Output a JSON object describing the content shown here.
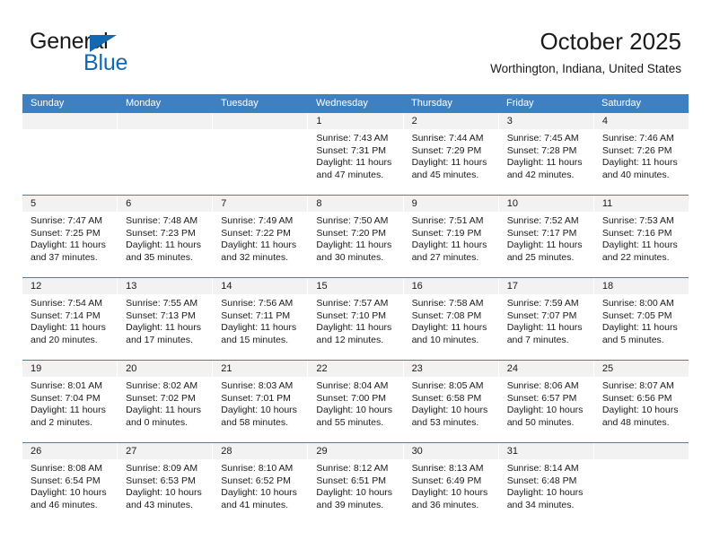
{
  "brand": {
    "name_top": "General",
    "name_bottom": "Blue",
    "accent_color": "#1268b3"
  },
  "header": {
    "title": "October 2025",
    "subtitle": "Worthington, Indiana, United States"
  },
  "theme": {
    "header_row_color": "#3f80c0",
    "daynum_band_color": "#f2f2f2",
    "text_color": "#1a1a1a"
  },
  "labels": {
    "sunrise_prefix": "Sunrise:",
    "sunset_prefix": "Sunset:",
    "daylight_prefix": "Daylight:"
  },
  "weekdays": [
    "Sunday",
    "Monday",
    "Tuesday",
    "Wednesday",
    "Thursday",
    "Friday",
    "Saturday"
  ],
  "weeks": [
    [
      {
        "day": "",
        "empty": true
      },
      {
        "day": "",
        "empty": true
      },
      {
        "day": "",
        "empty": true
      },
      {
        "day": "1",
        "sunrise": "Sunrise: 7:43 AM",
        "sunset": "Sunset: 7:31 PM",
        "daylight_l1": "Daylight: 11 hours",
        "daylight_l2": "and 47 minutes."
      },
      {
        "day": "2",
        "sunrise": "Sunrise: 7:44 AM",
        "sunset": "Sunset: 7:29 PM",
        "daylight_l1": "Daylight: 11 hours",
        "daylight_l2": "and 45 minutes."
      },
      {
        "day": "3",
        "sunrise": "Sunrise: 7:45 AM",
        "sunset": "Sunset: 7:28 PM",
        "daylight_l1": "Daylight: 11 hours",
        "daylight_l2": "and 42 minutes."
      },
      {
        "day": "4",
        "sunrise": "Sunrise: 7:46 AM",
        "sunset": "Sunset: 7:26 PM",
        "daylight_l1": "Daylight: 11 hours",
        "daylight_l2": "and 40 minutes."
      }
    ],
    [
      {
        "day": "5",
        "sunrise": "Sunrise: 7:47 AM",
        "sunset": "Sunset: 7:25 PM",
        "daylight_l1": "Daylight: 11 hours",
        "daylight_l2": "and 37 minutes."
      },
      {
        "day": "6",
        "sunrise": "Sunrise: 7:48 AM",
        "sunset": "Sunset: 7:23 PM",
        "daylight_l1": "Daylight: 11 hours",
        "daylight_l2": "and 35 minutes."
      },
      {
        "day": "7",
        "sunrise": "Sunrise: 7:49 AM",
        "sunset": "Sunset: 7:22 PM",
        "daylight_l1": "Daylight: 11 hours",
        "daylight_l2": "and 32 minutes."
      },
      {
        "day": "8",
        "sunrise": "Sunrise: 7:50 AM",
        "sunset": "Sunset: 7:20 PM",
        "daylight_l1": "Daylight: 11 hours",
        "daylight_l2": "and 30 minutes."
      },
      {
        "day": "9",
        "sunrise": "Sunrise: 7:51 AM",
        "sunset": "Sunset: 7:19 PM",
        "daylight_l1": "Daylight: 11 hours",
        "daylight_l2": "and 27 minutes."
      },
      {
        "day": "10",
        "sunrise": "Sunrise: 7:52 AM",
        "sunset": "Sunset: 7:17 PM",
        "daylight_l1": "Daylight: 11 hours",
        "daylight_l2": "and 25 minutes."
      },
      {
        "day": "11",
        "sunrise": "Sunrise: 7:53 AM",
        "sunset": "Sunset: 7:16 PM",
        "daylight_l1": "Daylight: 11 hours",
        "daylight_l2": "and 22 minutes."
      }
    ],
    [
      {
        "day": "12",
        "sunrise": "Sunrise: 7:54 AM",
        "sunset": "Sunset: 7:14 PM",
        "daylight_l1": "Daylight: 11 hours",
        "daylight_l2": "and 20 minutes."
      },
      {
        "day": "13",
        "sunrise": "Sunrise: 7:55 AM",
        "sunset": "Sunset: 7:13 PM",
        "daylight_l1": "Daylight: 11 hours",
        "daylight_l2": "and 17 minutes."
      },
      {
        "day": "14",
        "sunrise": "Sunrise: 7:56 AM",
        "sunset": "Sunset: 7:11 PM",
        "daylight_l1": "Daylight: 11 hours",
        "daylight_l2": "and 15 minutes."
      },
      {
        "day": "15",
        "sunrise": "Sunrise: 7:57 AM",
        "sunset": "Sunset: 7:10 PM",
        "daylight_l1": "Daylight: 11 hours",
        "daylight_l2": "and 12 minutes."
      },
      {
        "day": "16",
        "sunrise": "Sunrise: 7:58 AM",
        "sunset": "Sunset: 7:08 PM",
        "daylight_l1": "Daylight: 11 hours",
        "daylight_l2": "and 10 minutes."
      },
      {
        "day": "17",
        "sunrise": "Sunrise: 7:59 AM",
        "sunset": "Sunset: 7:07 PM",
        "daylight_l1": "Daylight: 11 hours",
        "daylight_l2": "and 7 minutes."
      },
      {
        "day": "18",
        "sunrise": "Sunrise: 8:00 AM",
        "sunset": "Sunset: 7:05 PM",
        "daylight_l1": "Daylight: 11 hours",
        "daylight_l2": "and 5 minutes."
      }
    ],
    [
      {
        "day": "19",
        "sunrise": "Sunrise: 8:01 AM",
        "sunset": "Sunset: 7:04 PM",
        "daylight_l1": "Daylight: 11 hours",
        "daylight_l2": "and 2 minutes."
      },
      {
        "day": "20",
        "sunrise": "Sunrise: 8:02 AM",
        "sunset": "Sunset: 7:02 PM",
        "daylight_l1": "Daylight: 11 hours",
        "daylight_l2": "and 0 minutes."
      },
      {
        "day": "21",
        "sunrise": "Sunrise: 8:03 AM",
        "sunset": "Sunset: 7:01 PM",
        "daylight_l1": "Daylight: 10 hours",
        "daylight_l2": "and 58 minutes."
      },
      {
        "day": "22",
        "sunrise": "Sunrise: 8:04 AM",
        "sunset": "Sunset: 7:00 PM",
        "daylight_l1": "Daylight: 10 hours",
        "daylight_l2": "and 55 minutes."
      },
      {
        "day": "23",
        "sunrise": "Sunrise: 8:05 AM",
        "sunset": "Sunset: 6:58 PM",
        "daylight_l1": "Daylight: 10 hours",
        "daylight_l2": "and 53 minutes."
      },
      {
        "day": "24",
        "sunrise": "Sunrise: 8:06 AM",
        "sunset": "Sunset: 6:57 PM",
        "daylight_l1": "Daylight: 10 hours",
        "daylight_l2": "and 50 minutes."
      },
      {
        "day": "25",
        "sunrise": "Sunrise: 8:07 AM",
        "sunset": "Sunset: 6:56 PM",
        "daylight_l1": "Daylight: 10 hours",
        "daylight_l2": "and 48 minutes."
      }
    ],
    [
      {
        "day": "26",
        "sunrise": "Sunrise: 8:08 AM",
        "sunset": "Sunset: 6:54 PM",
        "daylight_l1": "Daylight: 10 hours",
        "daylight_l2": "and 46 minutes."
      },
      {
        "day": "27",
        "sunrise": "Sunrise: 8:09 AM",
        "sunset": "Sunset: 6:53 PM",
        "daylight_l1": "Daylight: 10 hours",
        "daylight_l2": "and 43 minutes."
      },
      {
        "day": "28",
        "sunrise": "Sunrise: 8:10 AM",
        "sunset": "Sunset: 6:52 PM",
        "daylight_l1": "Daylight: 10 hours",
        "daylight_l2": "and 41 minutes."
      },
      {
        "day": "29",
        "sunrise": "Sunrise: 8:12 AM",
        "sunset": "Sunset: 6:51 PM",
        "daylight_l1": "Daylight: 10 hours",
        "daylight_l2": "and 39 minutes."
      },
      {
        "day": "30",
        "sunrise": "Sunrise: 8:13 AM",
        "sunset": "Sunset: 6:49 PM",
        "daylight_l1": "Daylight: 10 hours",
        "daylight_l2": "and 36 minutes."
      },
      {
        "day": "31",
        "sunrise": "Sunrise: 8:14 AM",
        "sunset": "Sunset: 6:48 PM",
        "daylight_l1": "Daylight: 10 hours",
        "daylight_l2": "and 34 minutes."
      },
      {
        "day": "",
        "empty": true
      }
    ]
  ]
}
